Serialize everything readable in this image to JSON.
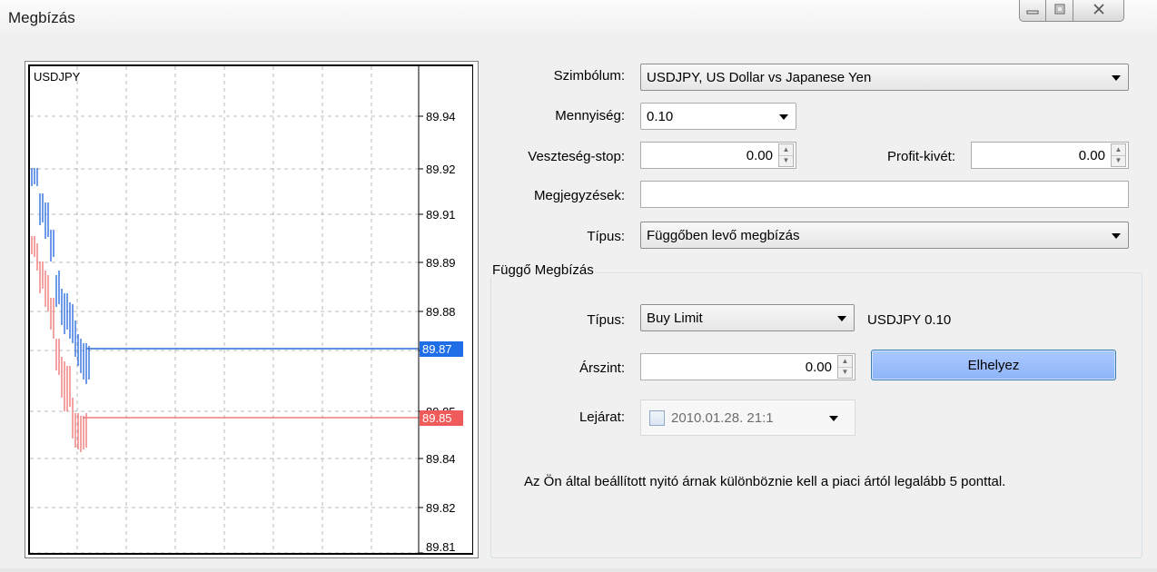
{
  "window": {
    "title": "Megbízás",
    "buttons": {
      "minimize": "minimize-icon",
      "maximize": "maximize-icon",
      "close": "close-icon"
    }
  },
  "chart": {
    "symbol_label": "USDJPY",
    "price_ticks": [
      "89.94",
      "89.92",
      "89.91",
      "89.89",
      "89.88",
      "89.87",
      "89.85",
      "89.84",
      "89.82",
      "89.81"
    ],
    "ask_price": "89.87",
    "bid_price": "89.85",
    "colors": {
      "ask": "#2f6fe0",
      "bid": "#f07a7a",
      "ask_tag": "#1f6ee8",
      "bid_tag": "#ef5b5b"
    }
  },
  "form": {
    "symbol_label": "Szimbólum:",
    "symbol_value": "USDJPY, US Dollar vs Japanese Yen",
    "volume_label": "Mennyiség:",
    "volume_value": "0.10",
    "sl_label": "Veszteség-stop:",
    "sl_value": "0.00",
    "tp_label": "Profit-kivét:",
    "tp_value": "0.00",
    "comment_label": "Megjegyzések:",
    "comment_value": "",
    "type_label": "Típus:",
    "type_value": "Függőben levő megbízás"
  },
  "pending": {
    "group_title": "Függő Megbízás",
    "type_label": "Típus:",
    "type_value": "Buy Limit",
    "summary": "USDJPY 0.10",
    "price_label": "Árszint:",
    "price_value": "0.00",
    "place_button": "Elhelyez",
    "expiry_label": "Lejárat:",
    "expiry_value": "2010.01.28. 21:1",
    "expiry_enabled": false,
    "note": "Az Ön által beállított nyitó árnak különböznie kell a piaci ártól legalább 5 ponttal."
  }
}
